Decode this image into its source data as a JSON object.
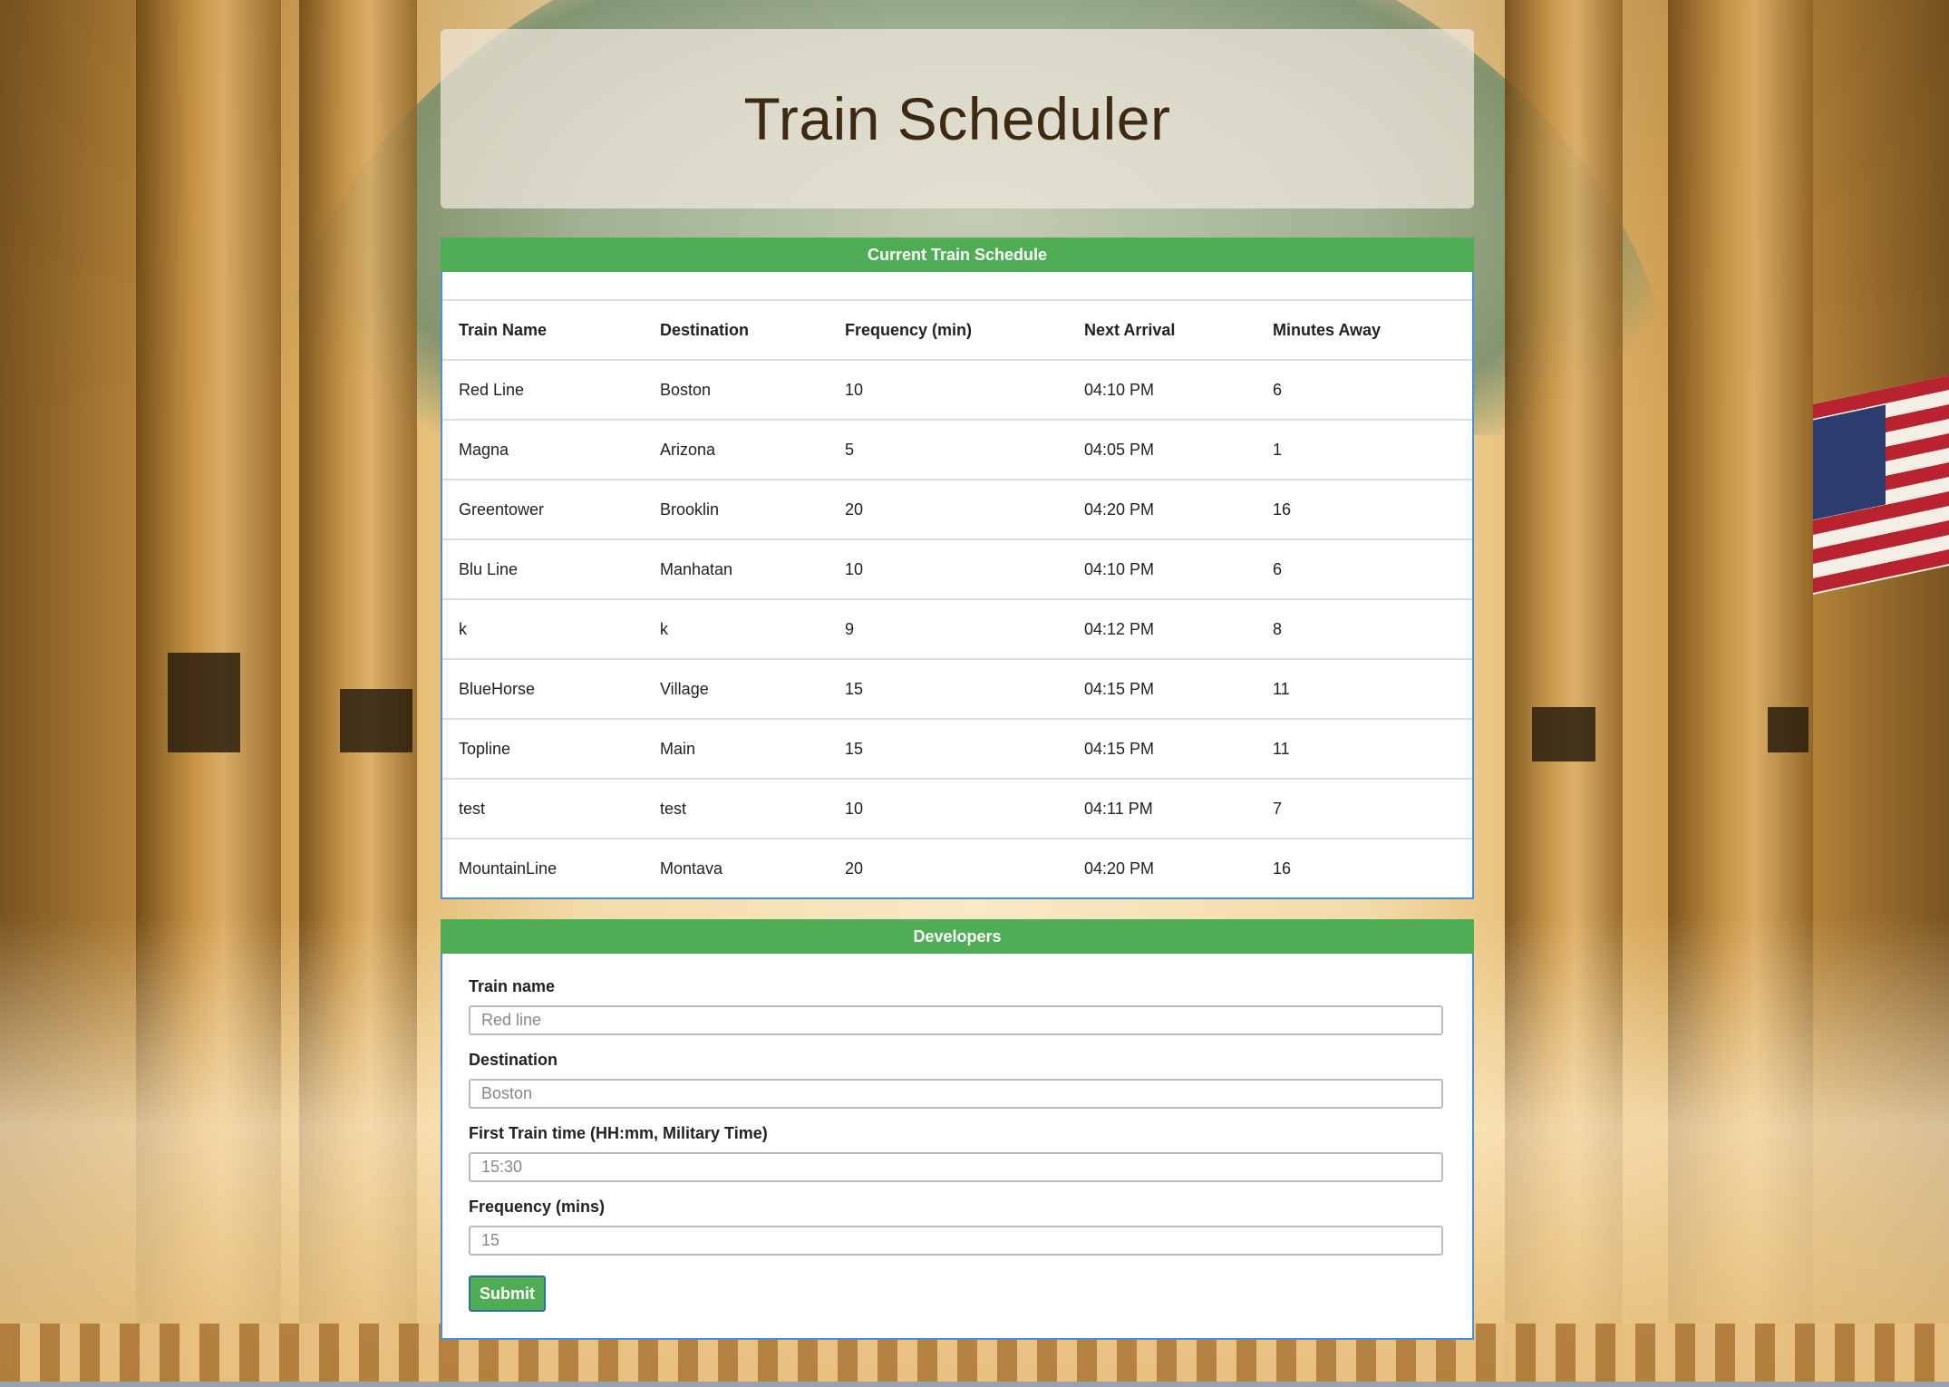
{
  "header": {
    "title": "Train Scheduler"
  },
  "schedule": {
    "heading": "Current Train Schedule",
    "columns": [
      "Train Name",
      "Destination",
      "Frequency (min)",
      "Next Arrival",
      "Minutes Away"
    ],
    "rows": [
      [
        "Red Line",
        "Boston",
        "10",
        "04:10 PM",
        "6"
      ],
      [
        "Magna",
        "Arizona",
        "5",
        "04:05 PM",
        "1"
      ],
      [
        "Greentower",
        "Brooklin",
        "20",
        "04:20 PM",
        "16"
      ],
      [
        "Blu Line",
        "Manhatan",
        "10",
        "04:10 PM",
        "6"
      ],
      [
        "k",
        "k",
        "9",
        "04:12 PM",
        "8"
      ],
      [
        "BlueHorse",
        "Village",
        "15",
        "04:15 PM",
        "11"
      ],
      [
        "Topline",
        "Main",
        "15",
        "04:15 PM",
        "11"
      ],
      [
        "test",
        "test",
        "10",
        "04:11 PM",
        "7"
      ],
      [
        "MountainLine",
        "Montava",
        "20",
        "04:20 PM",
        "16"
      ]
    ]
  },
  "form": {
    "heading": "Developers",
    "train_name": {
      "label": "Train name",
      "placeholder": "Red line",
      "value": ""
    },
    "destination": {
      "label": "Destination",
      "placeholder": "Boston",
      "value": ""
    },
    "first_time": {
      "label": "First Train time (HH:mm, Military Time)",
      "placeholder": "15:30",
      "value": ""
    },
    "frequency": {
      "label": "Frequency (mins)",
      "placeholder": "15",
      "value": ""
    },
    "submit_label": "Submit"
  },
  "colors": {
    "panel_header": "#4fae55",
    "panel_border": "#4a90d9",
    "title_text": "#3e2a12"
  }
}
